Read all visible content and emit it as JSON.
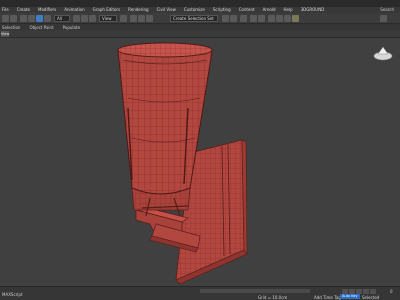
{
  "menu": {
    "items": [
      "File",
      "Create",
      "Modifiers",
      "Animation",
      "Graph Editors",
      "Rendering",
      "Civil View",
      "Customize",
      "Scripting",
      "Content",
      "Arnold",
      "Help",
      "3DGROUND"
    ],
    "search": "Search"
  },
  "toolbar": {
    "filter_value": "All",
    "view_value": "View",
    "selection_set_value": "Create Selection Set"
  },
  "ribbon": {
    "items": [
      "Selection",
      "Object Paint",
      "Populate"
    ]
  },
  "viewport": {
    "tab_label": "View",
    "model_color": "#b24740",
    "wire_color": "#7a2420",
    "background_color": "#404040"
  },
  "status": {
    "left_text": "MAXScript",
    "grid_text": "Grid = 10.0cm",
    "add_time_tag": "Add Time Tag",
    "auto_key": "Auto Key",
    "selected": "Selected",
    "frame": "0"
  },
  "icons": [
    "undo-icon",
    "redo-icon",
    "link-icon",
    "unlink-icon",
    "bind-icon",
    "select-icon",
    "select-region-icon",
    "move-icon",
    "rotate-icon",
    "scale-icon",
    "snap-icon",
    "mirror-icon",
    "align-icon",
    "render-icon",
    "teapot-icon",
    "viewcube-icon"
  ]
}
